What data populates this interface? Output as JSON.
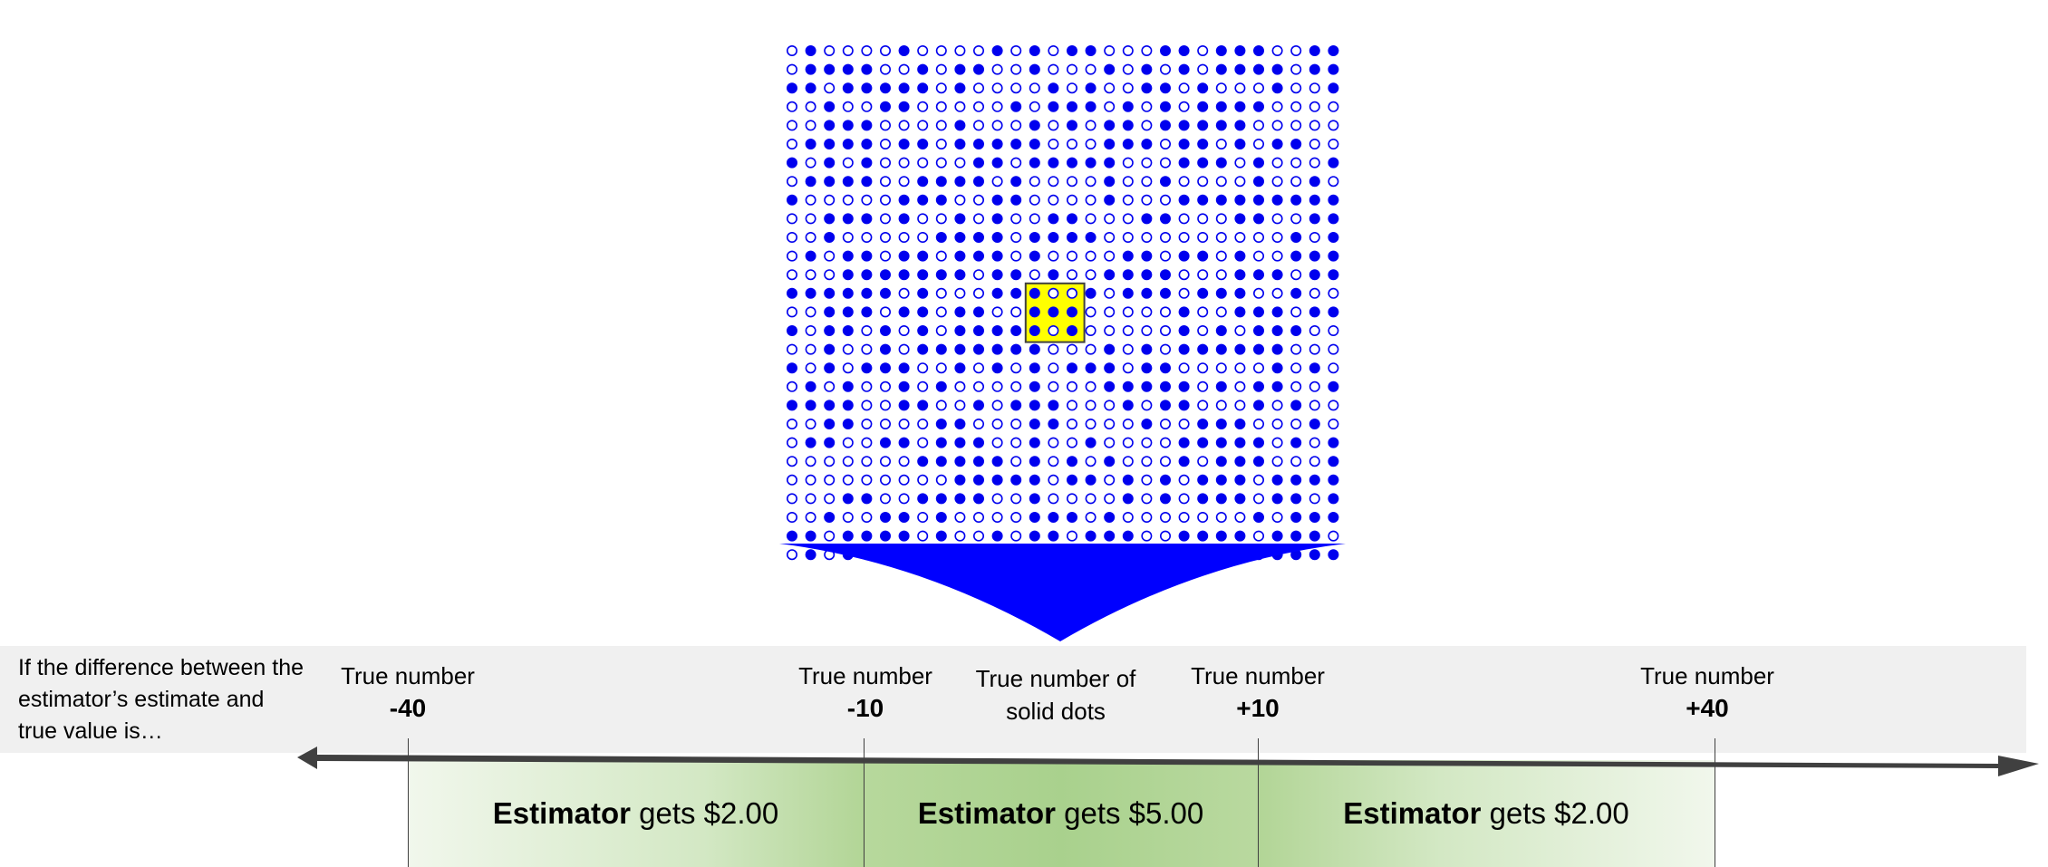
{
  "question": "If the difference between the estimator’s estimate and true value is…",
  "ticks": [
    {
      "label": "True number",
      "value": "-40"
    },
    {
      "label": "True number",
      "value": "-10"
    },
    {
      "label": "True number",
      "value": "+10"
    },
    {
      "label": "True number",
      "value": "+40"
    }
  ],
  "center_label": "True number of solid dots",
  "zones": [
    {
      "bold": "Estimator",
      "text": " gets $2.00"
    },
    {
      "bold": "Estimator",
      "text": " gets $5.00"
    },
    {
      "bold": "Estimator",
      "text": " gets $2.00"
    }
  ],
  "grid": {
    "rows": 30,
    "cols": 30,
    "highlight_rows": [
      13,
      14,
      15
    ],
    "highlight_cols": [
      13,
      14,
      15
    ]
  },
  "colors": {
    "dot": "#0000ee",
    "highlight": "#ffff00",
    "funnel": "#0000ff",
    "axis": "#404040"
  }
}
